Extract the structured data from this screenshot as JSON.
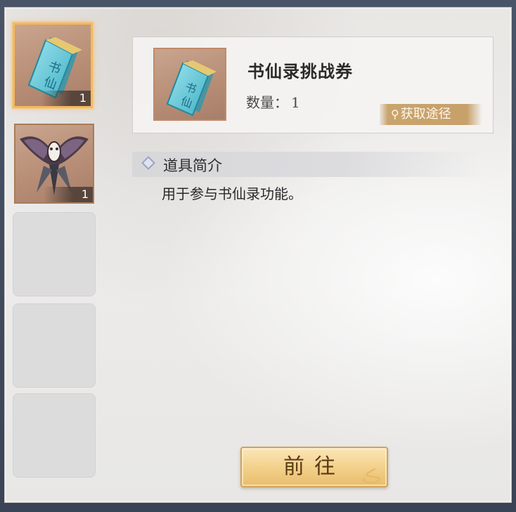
{
  "inventory": {
    "slots": [
      {
        "name": "书仙录挑战券",
        "count": "1",
        "selected": true,
        "icon": "scroll-ticket-icon"
      },
      {
        "name": "kite",
        "count": "1",
        "selected": false,
        "icon": "swallow-kite-icon"
      },
      {
        "empty": true
      },
      {
        "empty": true
      },
      {
        "empty": true
      }
    ]
  },
  "detail": {
    "item_name": "书仙录挑战券",
    "quantity_label": "数量：",
    "quantity_value": "1",
    "acquire_label": "获取途径",
    "section_title": "道具简介",
    "description": "用于参与书仙录功能。"
  },
  "actions": {
    "go_label": "前往"
  },
  "colors": {
    "selected_border": "#f6b85a",
    "acquire_bg": "#c9a46d",
    "button_gold": "#f2cf88"
  }
}
